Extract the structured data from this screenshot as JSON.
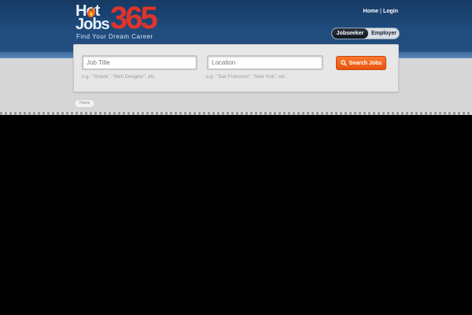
{
  "brand": {
    "logo_line1": "Hot",
    "logo_line2": "Jobs",
    "logo_number": "365",
    "tagline": "Find Your Dream Career"
  },
  "topnav": {
    "home": "Home",
    "separator": "|",
    "login": "Login"
  },
  "toggle": {
    "active": "Jobseeker",
    "inactive": "Employer"
  },
  "search": {
    "job_title_placeholder": "Job Title",
    "location_placeholder": "Location",
    "job_title_hint": "e.g.: \"Oracle\", \"Web Designer\", etc.",
    "location_hint": "e.g.: \"San Francisco\", \"New York\", etc.",
    "button_label": "Search Jobs"
  },
  "breadcrumb": {
    "home": "Home"
  },
  "colors": {
    "header": "#1f4b7d",
    "accent_red": "#e0342b",
    "button_orange": "#f26a1f"
  }
}
